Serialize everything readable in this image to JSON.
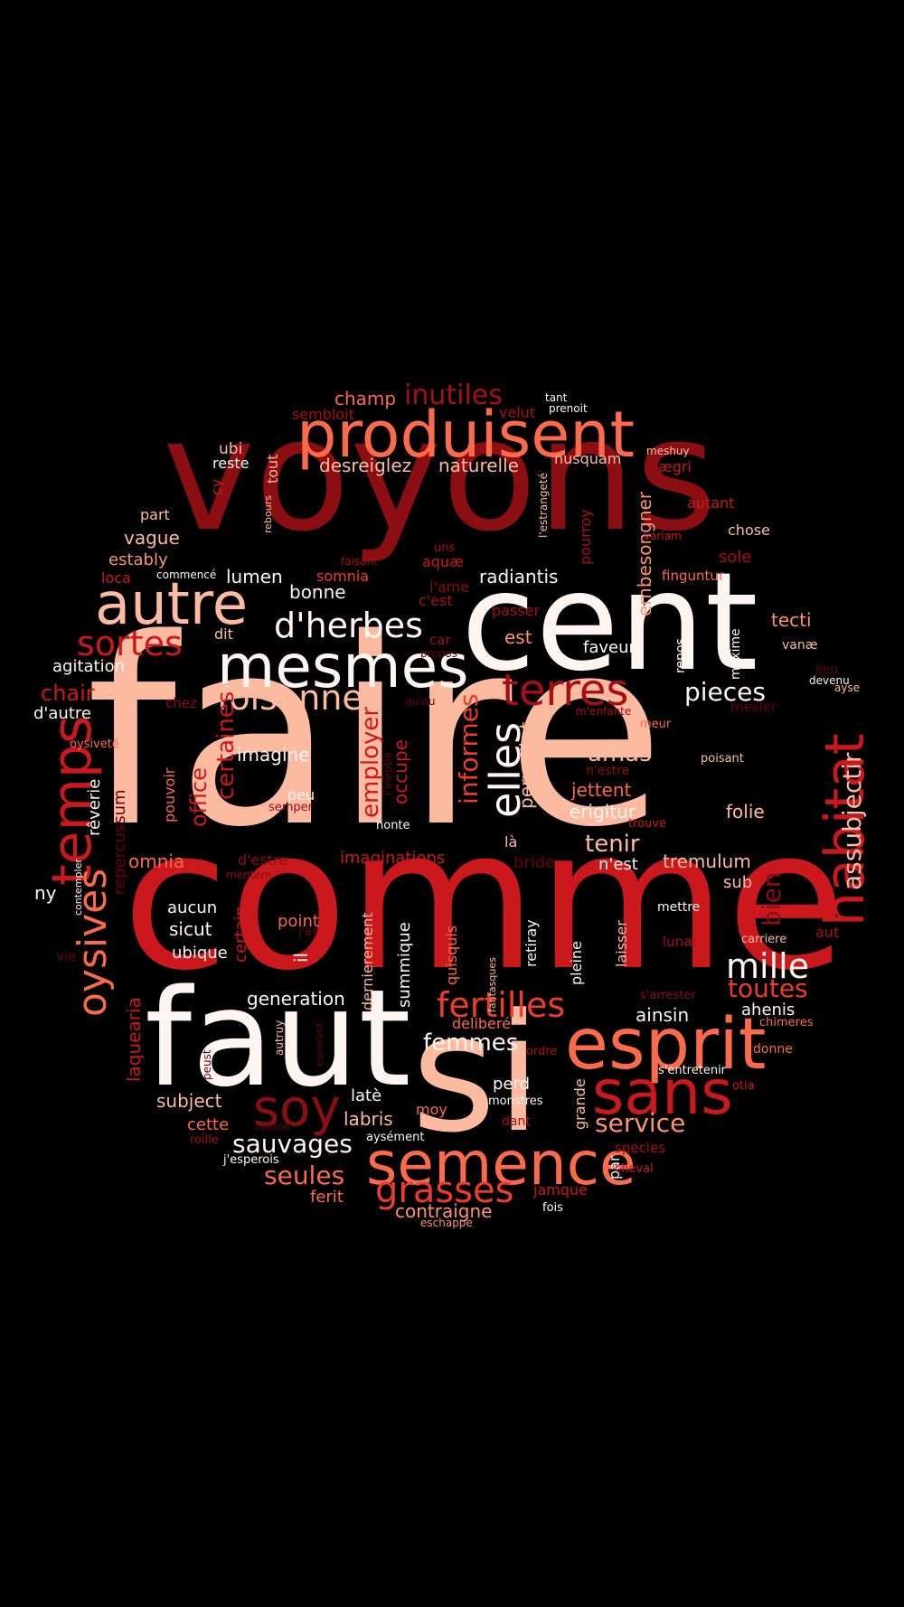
{
  "colors": {
    "background": "#000000",
    "palette": {
      "w": "#fff5f0",
      "l": "#fcbba1",
      "m": "#fc9272",
      "s": "#fb6a4a",
      "o": "#ef3b2c",
      "r": "#cb181d",
      "d": "#a50f15",
      "k": "#8b0e12",
      "x": "#67000d"
    }
  },
  "words": [
    {
      "text": "faire",
      "c": "l"
    },
    {
      "text": "comme",
      "c": "r"
    },
    {
      "text": "voyons",
      "c": "k"
    },
    {
      "text": "cent",
      "c": "w"
    },
    {
      "text": "faut",
      "c": "w"
    },
    {
      "text": "si",
      "c": "l"
    },
    {
      "text": "esprit",
      "c": "s"
    },
    {
      "text": "sans",
      "c": "r"
    },
    {
      "text": "produisent",
      "c": "s"
    },
    {
      "text": "mesmes",
      "c": "w"
    },
    {
      "text": "autre",
      "c": "l"
    },
    {
      "text": "semence",
      "c": "s"
    },
    {
      "text": "temps",
      "c": "r"
    },
    {
      "text": "habitat",
      "c": "r"
    },
    {
      "text": "terres",
      "c": "d"
    },
    {
      "text": "elles",
      "c": "w"
    },
    {
      "text": "oysives",
      "c": "s"
    },
    {
      "text": "soy",
      "c": "k"
    },
    {
      "text": "grasses",
      "c": "o"
    },
    {
      "text": "d'herbes",
      "c": "w"
    },
    {
      "text": "foisonner",
      "c": "l"
    },
    {
      "text": "fertilles",
      "c": "o"
    },
    {
      "text": "sortes",
      "c": "r"
    },
    {
      "text": "mille",
      "c": "w"
    },
    {
      "text": "inutiles",
      "c": "d"
    },
    {
      "text": "pieces",
      "c": "w"
    },
    {
      "text": "informes",
      "c": "o"
    },
    {
      "text": "sauvages",
      "c": "w"
    },
    {
      "text": "seules",
      "c": "s"
    },
    {
      "text": "service",
      "c": "m"
    },
    {
      "text": "toutes",
      "c": "o"
    },
    {
      "text": "assubjectir",
      "c": "l"
    },
    {
      "text": "employer",
      "c": "r"
    },
    {
      "text": "certaines",
      "c": "r"
    },
    {
      "text": "femmes",
      "c": "w"
    },
    {
      "text": "desreiglez",
      "c": "l"
    },
    {
      "text": "naturelle",
      "c": "l"
    },
    {
      "text": "tenir",
      "c": "l"
    },
    {
      "text": "amas",
      "c": "l"
    },
    {
      "text": "office",
      "c": "r"
    },
    {
      "text": "chair",
      "c": "r"
    },
    {
      "text": "contraigne",
      "c": "m"
    },
    {
      "text": "bien",
      "c": "k"
    },
    {
      "text": "champ",
      "c": "s"
    },
    {
      "text": "radiantis",
      "c": "w"
    },
    {
      "text": "embesongner",
      "c": "m"
    },
    {
      "text": "est",
      "c": "m"
    },
    {
      "text": "jettent",
      "c": "s"
    },
    {
      "text": "tremulum",
      "c": "l"
    },
    {
      "text": "imaginations",
      "c": "r"
    },
    {
      "text": "generation",
      "c": "w"
    },
    {
      "text": "ainsin",
      "c": "w"
    },
    {
      "text": "ahenis",
      "c": "w"
    },
    {
      "text": "subject",
      "c": "l"
    },
    {
      "text": "labris",
      "c": "l"
    },
    {
      "text": "ferit",
      "c": "s"
    },
    {
      "text": "imagine",
      "c": "w"
    },
    {
      "text": "erigitur",
      "c": "w"
    },
    {
      "text": "occupe",
      "c": "r"
    },
    {
      "text": "pervolitat",
      "c": "l"
    },
    {
      "text": "folie",
      "c": "l"
    },
    {
      "text": "bonne",
      "c": "w"
    },
    {
      "text": "lumen",
      "c": "w"
    },
    {
      "text": "faveur",
      "c": "w"
    },
    {
      "text": "tecti",
      "c": "m"
    },
    {
      "text": "sole",
      "c": "d"
    },
    {
      "text": "vague",
      "c": "l"
    },
    {
      "text": "estably",
      "c": "m"
    },
    {
      "text": "agitation",
      "c": "w"
    },
    {
      "text": "d'autre",
      "c": "w"
    },
    {
      "text": "rêverie",
      "c": "w"
    },
    {
      "text": "pouvoir",
      "c": "s"
    },
    {
      "text": "repercussum",
      "c": "x"
    },
    {
      "text": "omnia",
      "c": "s"
    },
    {
      "text": "ny",
      "c": "w"
    },
    {
      "text": "laquearia",
      "c": "r"
    },
    {
      "text": "certain",
      "c": "r"
    },
    {
      "text": "sicut",
      "c": "w"
    },
    {
      "text": "aucun",
      "c": "w"
    },
    {
      "text": "ubique",
      "c": "w"
    },
    {
      "text": "point",
      "c": "s"
    },
    {
      "text": "il",
      "c": "w"
    },
    {
      "text": "dernierement",
      "c": "l"
    },
    {
      "text": "summique",
      "c": "w"
    },
    {
      "text": "quisquis",
      "c": "s"
    },
    {
      "text": "retiray",
      "c": "w"
    },
    {
      "text": "pleine",
      "c": "w"
    },
    {
      "text": "laisser",
      "c": "l"
    },
    {
      "text": "deliberé",
      "c": "s"
    },
    {
      "text": "perd",
      "c": "w"
    },
    {
      "text": "latè",
      "c": "w"
    },
    {
      "text": "grande",
      "c": "l"
    },
    {
      "text": "moy",
      "c": "s"
    },
    {
      "text": "jamque",
      "c": "r"
    },
    {
      "text": "par",
      "c": "w"
    },
    {
      "text": "cette",
      "c": "s"
    },
    {
      "text": "chose",
      "c": "l"
    },
    {
      "text": "autant",
      "c": "r"
    },
    {
      "text": "finguntur",
      "c": "s"
    },
    {
      "text": "vanæ",
      "c": "l"
    },
    {
      "text": "maxime",
      "c": "w"
    },
    {
      "text": "repos",
      "c": "w"
    },
    {
      "text": "devenu",
      "c": "w"
    },
    {
      "text": "lieu",
      "c": "x"
    },
    {
      "text": "mesler",
      "c": "x"
    },
    {
      "text": "poisant",
      "c": "l"
    },
    {
      "text": "trouve",
      "c": "r"
    },
    {
      "text": "n'est",
      "c": "w"
    },
    {
      "text": "bride",
      "c": "x"
    },
    {
      "text": "là",
      "c": "l"
    },
    {
      "text": "sub",
      "c": "l"
    },
    {
      "text": "mettre",
      "c": "w"
    },
    {
      "text": "carriere",
      "c": "l"
    },
    {
      "text": "aut",
      "c": "d"
    },
    {
      "text": "lunæ",
      "c": "d"
    },
    {
      "text": "s'arrester",
      "c": "k"
    },
    {
      "text": "chimeres",
      "c": "s"
    },
    {
      "text": "donne",
      "c": "s"
    },
    {
      "text": "s'entretenir",
      "c": "w"
    },
    {
      "text": "otia",
      "c": "r"
    },
    {
      "text": "species",
      "c": "d"
    },
    {
      "text": "cheval",
      "c": "r"
    },
    {
      "text": "fois",
      "c": "w"
    },
    {
      "text": "eschappe",
      "c": "m"
    },
    {
      "text": "ordre",
      "c": "d"
    },
    {
      "text": "monstres",
      "c": "w"
    },
    {
      "text": "dant",
      "c": "d"
    },
    {
      "text": "aysément",
      "c": "w"
    },
    {
      "text": "j'esperois",
      "c": "w"
    },
    {
      "text": "roille",
      "c": "d"
    },
    {
      "text": "rassoir",
      "c": "x"
    },
    {
      "text": "peust",
      "c": "x"
    },
    {
      "text": "esperant",
      "c": "x"
    },
    {
      "text": "autruy",
      "c": "l"
    },
    {
      "text": "fantasques",
      "c": "l"
    },
    {
      "text": "j'ay",
      "c": "x"
    },
    {
      "text": "vie",
      "c": "x"
    },
    {
      "text": "contempler",
      "c": "w"
    },
    {
      "text": "mentem",
      "c": "k"
    },
    {
      "text": "d'estre",
      "c": "k"
    },
    {
      "text": "honte",
      "c": "w"
    },
    {
      "text": "semper",
      "c": "d"
    },
    {
      "text": "peu",
      "c": "w"
    },
    {
      "text": "l'ineptie",
      "c": "x"
    },
    {
      "text": "chez",
      "c": "k"
    },
    {
      "text": "qu'au",
      "c": "x"
    },
    {
      "text": "propos",
      "c": "x"
    },
    {
      "text": "car",
      "c": "d"
    },
    {
      "text": "c'est",
      "c": "d"
    },
    {
      "text": "l'ame",
      "c": "k"
    },
    {
      "text": "dit",
      "c": "l"
    },
    {
      "text": "oysiveté",
      "c": "s"
    },
    {
      "text": "loca",
      "c": "r"
    },
    {
      "text": "commencé",
      "c": "w"
    },
    {
      "text": "faisant",
      "c": "d"
    },
    {
      "text": "somnia",
      "c": "o"
    },
    {
      "text": "aquæ",
      "c": "r"
    },
    {
      "text": "uns",
      "c": "d"
    },
    {
      "text": "part",
      "c": "l"
    },
    {
      "text": "rebours",
      "c": "l"
    },
    {
      "text": "cy",
      "c": "r"
    },
    {
      "text": "ubi",
      "c": "l"
    },
    {
      "text": "reste",
      "c": "w"
    },
    {
      "text": "tout",
      "c": "l"
    },
    {
      "text": "sembloit",
      "c": "d"
    },
    {
      "text": "velut",
      "c": "d"
    },
    {
      "text": "tant",
      "c": "w"
    },
    {
      "text": "prenoit",
      "c": "w"
    },
    {
      "text": "nusquam",
      "c": "l"
    },
    {
      "text": "meshuy",
      "c": "l"
    },
    {
      "text": "ægri",
      "c": "r"
    },
    {
      "text": "l'estrangeté",
      "c": "l"
    },
    {
      "text": "pourroy",
      "c": "d"
    },
    {
      "text": "variam",
      "c": "r"
    },
    {
      "text": "passer",
      "c": "d"
    },
    {
      "text": "m'enfante",
      "c": "d"
    },
    {
      "text": "meur",
      "c": "s"
    },
    {
      "text": "n'estre",
      "c": "k"
    },
    {
      "text": "ayse",
      "c": "l"
    }
  ]
}
